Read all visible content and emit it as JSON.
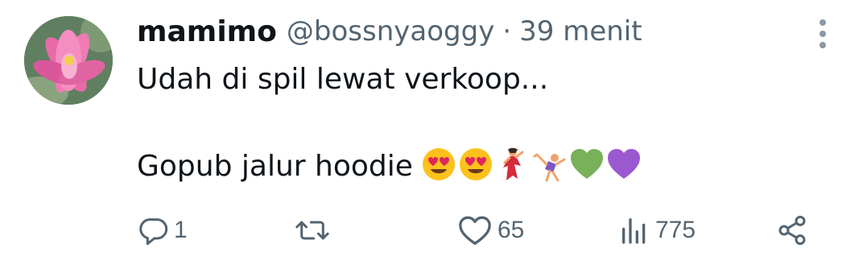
{
  "tweet": {
    "display_name": "mamimo",
    "handle": "@bossnyaoggy",
    "separator": "·",
    "time": "39 menit",
    "text": "Udah di spil lewat verkoop...\n\nGopub jalur hoodie",
    "emojis": [
      "heart-eyes-emoji",
      "heart-eyes-emoji",
      "dancer-emoji",
      "cartwheel-emoji",
      "green-heart-emoji",
      "purple-heart-emoji"
    ]
  },
  "actions": {
    "reply_count": "1",
    "retweet_count": "",
    "like_count": "65",
    "views_count": "775"
  },
  "colors": {
    "text": "#0f1419",
    "muted": "#536471"
  },
  "icons": [
    "more-vertical-icon",
    "reply-icon",
    "retweet-icon",
    "like-icon",
    "views-icon",
    "share-icon"
  ]
}
